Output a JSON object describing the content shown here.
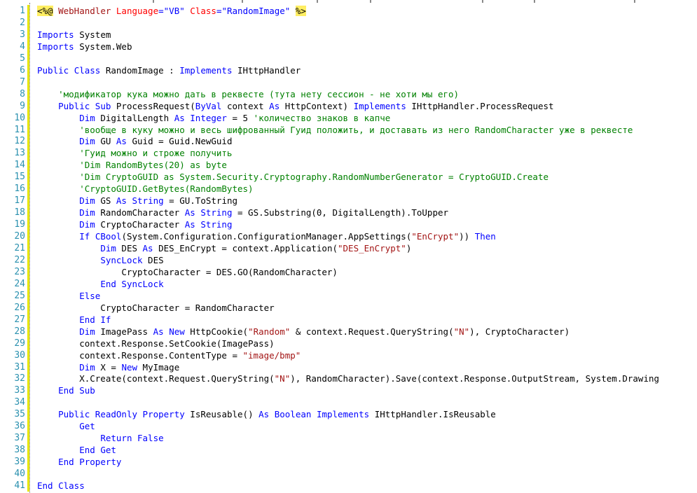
{
  "editor": {
    "language": "VB",
    "colors": {
      "line_number": "#2b91af",
      "keyword": "#0000ff",
      "string": "#a31515",
      "comment": "#008000",
      "directive_highlight": "#ffee62",
      "changed_line_marker": "#e6e600"
    },
    "lines": [
      {
        "n": "1",
        "changed": true,
        "tokens": [
          {
            "t": "dir",
            "v": "<%@"
          },
          {
            "t": "text",
            "v": " "
          },
          {
            "t": "str",
            "v": "WebHandler"
          },
          {
            "t": "text",
            "v": " "
          },
          {
            "t": "attr",
            "v": "Language"
          },
          {
            "t": "kw",
            "v": "=\"VB\""
          },
          {
            "t": "text",
            "v": " "
          },
          {
            "t": "attr",
            "v": "Class"
          },
          {
            "t": "kw",
            "v": "=\"RandomImage\""
          },
          {
            "t": "text",
            "v": " "
          },
          {
            "t": "dir",
            "v": "%>"
          }
        ]
      },
      {
        "n": "2",
        "changed": true,
        "tokens": []
      },
      {
        "n": "3",
        "changed": true,
        "tokens": [
          {
            "t": "kw",
            "v": "Imports"
          },
          {
            "t": "text",
            "v": " System"
          }
        ]
      },
      {
        "n": "4",
        "changed": true,
        "tokens": [
          {
            "t": "kw",
            "v": "Imports"
          },
          {
            "t": "text",
            "v": " System.Web"
          }
        ]
      },
      {
        "n": "5",
        "changed": true,
        "tokens": []
      },
      {
        "n": "6",
        "changed": true,
        "tokens": [
          {
            "t": "kw",
            "v": "Public"
          },
          {
            "t": "text",
            "v": " "
          },
          {
            "t": "kw",
            "v": "Class"
          },
          {
            "t": "text",
            "v": " RandomImage : "
          },
          {
            "t": "kw",
            "v": "Implements"
          },
          {
            "t": "text",
            "v": " IHttpHandler"
          }
        ]
      },
      {
        "n": "7",
        "changed": true,
        "tokens": []
      },
      {
        "n": "8",
        "changed": true,
        "tokens": [
          {
            "t": "text",
            "v": "    "
          },
          {
            "t": "cm",
            "v": "'модификатор кука можно дать в реквесте (тута нету сессион - не хоти мы его)"
          }
        ]
      },
      {
        "n": "9",
        "changed": true,
        "tokens": [
          {
            "t": "text",
            "v": "    "
          },
          {
            "t": "kw",
            "v": "Public"
          },
          {
            "t": "text",
            "v": " "
          },
          {
            "t": "kw",
            "v": "Sub"
          },
          {
            "t": "text",
            "v": " ProcessRequest("
          },
          {
            "t": "kw",
            "v": "ByVal"
          },
          {
            "t": "text",
            "v": " context "
          },
          {
            "t": "kw",
            "v": "As"
          },
          {
            "t": "text",
            "v": " HttpContext) "
          },
          {
            "t": "kw",
            "v": "Implements"
          },
          {
            "t": "text",
            "v": " IHttpHandler.ProcessRequest"
          }
        ]
      },
      {
        "n": "10",
        "changed": true,
        "tokens": [
          {
            "t": "text",
            "v": "        "
          },
          {
            "t": "kw",
            "v": "Dim"
          },
          {
            "t": "text",
            "v": " DigitalLength "
          },
          {
            "t": "kw",
            "v": "As"
          },
          {
            "t": "text",
            "v": " "
          },
          {
            "t": "kw",
            "v": "Integer"
          },
          {
            "t": "text",
            "v": " = 5 "
          },
          {
            "t": "cm",
            "v": "'количество знаков в капче"
          }
        ]
      },
      {
        "n": "11",
        "changed": true,
        "tokens": [
          {
            "t": "text",
            "v": "        "
          },
          {
            "t": "cm",
            "v": "'вообще в куку можно и весь шифрованный Гуид положить, и доставать из него RandomCharacter уже в реквесте"
          }
        ]
      },
      {
        "n": "12",
        "changed": true,
        "tokens": [
          {
            "t": "text",
            "v": "        "
          },
          {
            "t": "kw",
            "v": "Dim"
          },
          {
            "t": "text",
            "v": " GU "
          },
          {
            "t": "kw",
            "v": "As"
          },
          {
            "t": "text",
            "v": " Guid = Guid.NewGuid"
          }
        ]
      },
      {
        "n": "13",
        "changed": true,
        "tokens": [
          {
            "t": "text",
            "v": "        "
          },
          {
            "t": "cm",
            "v": "'Гуид можно и строже получить"
          }
        ]
      },
      {
        "n": "14",
        "changed": true,
        "tokens": [
          {
            "t": "text",
            "v": "        "
          },
          {
            "t": "cm",
            "v": "'Dim RandomBytes(20) as byte"
          }
        ]
      },
      {
        "n": "15",
        "changed": true,
        "tokens": [
          {
            "t": "text",
            "v": "        "
          },
          {
            "t": "cm",
            "v": "'Dim CryptoGUID as System.Security.Cryptography.RandomNumberGenerator = CryptoGUID.Create"
          }
        ]
      },
      {
        "n": "16",
        "changed": true,
        "tokens": [
          {
            "t": "text",
            "v": "        "
          },
          {
            "t": "cm",
            "v": "'CryptoGUID.GetBytes(RandomBytes)"
          }
        ]
      },
      {
        "n": "17",
        "changed": true,
        "tokens": [
          {
            "t": "text",
            "v": "        "
          },
          {
            "t": "kw",
            "v": "Dim"
          },
          {
            "t": "text",
            "v": " GS "
          },
          {
            "t": "kw",
            "v": "As"
          },
          {
            "t": "text",
            "v": " "
          },
          {
            "t": "kw",
            "v": "String"
          },
          {
            "t": "text",
            "v": " = GU.ToString"
          }
        ]
      },
      {
        "n": "18",
        "changed": true,
        "tokens": [
          {
            "t": "text",
            "v": "        "
          },
          {
            "t": "kw",
            "v": "Dim"
          },
          {
            "t": "text",
            "v": " RandomCharacter "
          },
          {
            "t": "kw",
            "v": "As"
          },
          {
            "t": "text",
            "v": " "
          },
          {
            "t": "kw",
            "v": "String"
          },
          {
            "t": "text",
            "v": " = GS.Substring(0, DigitalLength).ToUpper"
          }
        ]
      },
      {
        "n": "19",
        "changed": true,
        "tokens": [
          {
            "t": "text",
            "v": "        "
          },
          {
            "t": "kw",
            "v": "Dim"
          },
          {
            "t": "text",
            "v": " CryptoCharacter "
          },
          {
            "t": "kw",
            "v": "As"
          },
          {
            "t": "text",
            "v": " "
          },
          {
            "t": "kw",
            "v": "String"
          }
        ]
      },
      {
        "n": "20",
        "changed": true,
        "tokens": [
          {
            "t": "text",
            "v": "        "
          },
          {
            "t": "kw",
            "v": "If"
          },
          {
            "t": "text",
            "v": " "
          },
          {
            "t": "kw",
            "v": "CBool"
          },
          {
            "t": "text",
            "v": "(System.Configuration.ConfigurationManager.AppSettings("
          },
          {
            "t": "str",
            "v": "\"EnCrypt\""
          },
          {
            "t": "text",
            "v": ")) "
          },
          {
            "t": "kw",
            "v": "Then"
          }
        ]
      },
      {
        "n": "21",
        "changed": true,
        "tokens": [
          {
            "t": "text",
            "v": "            "
          },
          {
            "t": "kw",
            "v": "Dim"
          },
          {
            "t": "text",
            "v": " DES "
          },
          {
            "t": "kw",
            "v": "As"
          },
          {
            "t": "text",
            "v": " DES_EnCrypt = context.Application("
          },
          {
            "t": "str",
            "v": "\"DES_EnCrypt\""
          },
          {
            "t": "text",
            "v": ")"
          }
        ]
      },
      {
        "n": "22",
        "changed": true,
        "tokens": [
          {
            "t": "text",
            "v": "            "
          },
          {
            "t": "kw",
            "v": "SyncLock"
          },
          {
            "t": "text",
            "v": " DES"
          }
        ]
      },
      {
        "n": "23",
        "changed": true,
        "tokens": [
          {
            "t": "text",
            "v": "                CryptoCharacter = DES.GO(RandomCharacter)"
          }
        ]
      },
      {
        "n": "24",
        "changed": true,
        "tokens": [
          {
            "t": "text",
            "v": "            "
          },
          {
            "t": "kw",
            "v": "End"
          },
          {
            "t": "text",
            "v": " "
          },
          {
            "t": "kw",
            "v": "SyncLock"
          }
        ]
      },
      {
        "n": "25",
        "changed": true,
        "tokens": [
          {
            "t": "text",
            "v": "        "
          },
          {
            "t": "kw",
            "v": "Else"
          }
        ]
      },
      {
        "n": "26",
        "changed": true,
        "tokens": [
          {
            "t": "text",
            "v": "            CryptoCharacter = RandomCharacter"
          }
        ]
      },
      {
        "n": "27",
        "changed": true,
        "tokens": [
          {
            "t": "text",
            "v": "        "
          },
          {
            "t": "kw",
            "v": "End"
          },
          {
            "t": "text",
            "v": " "
          },
          {
            "t": "kw",
            "v": "If"
          }
        ]
      },
      {
        "n": "28",
        "changed": true,
        "tokens": [
          {
            "t": "text",
            "v": "        "
          },
          {
            "t": "kw",
            "v": "Dim"
          },
          {
            "t": "text",
            "v": " ImagePass "
          },
          {
            "t": "kw",
            "v": "As"
          },
          {
            "t": "text",
            "v": " "
          },
          {
            "t": "kw",
            "v": "New"
          },
          {
            "t": "text",
            "v": " HttpCookie("
          },
          {
            "t": "str",
            "v": "\"Random\""
          },
          {
            "t": "text",
            "v": " & context.Request.QueryString("
          },
          {
            "t": "str",
            "v": "\"N\""
          },
          {
            "t": "text",
            "v": "), CryptoCharacter)"
          }
        ]
      },
      {
        "n": "29",
        "changed": true,
        "tokens": [
          {
            "t": "text",
            "v": "        context.Response.SetCookie(ImagePass)"
          }
        ]
      },
      {
        "n": "30",
        "changed": true,
        "tokens": [
          {
            "t": "text",
            "v": "        context.Response.ContentType = "
          },
          {
            "t": "str",
            "v": "\"image/bmp\""
          }
        ]
      },
      {
        "n": "31",
        "changed": true,
        "tokens": [
          {
            "t": "text",
            "v": "        "
          },
          {
            "t": "kw",
            "v": "Dim"
          },
          {
            "t": "text",
            "v": " X = "
          },
          {
            "t": "kw",
            "v": "New"
          },
          {
            "t": "text",
            "v": " MyImage"
          }
        ]
      },
      {
        "n": "32",
        "changed": true,
        "tokens": [
          {
            "t": "text",
            "v": "        X.Create(context.Request.QueryString("
          },
          {
            "t": "str",
            "v": "\"N\""
          },
          {
            "t": "text",
            "v": "), RandomCharacter).Save(context.Response.OutputStream, System.Drawing"
          }
        ]
      },
      {
        "n": "33",
        "changed": true,
        "tokens": [
          {
            "t": "text",
            "v": "    "
          },
          {
            "t": "kw",
            "v": "End"
          },
          {
            "t": "text",
            "v": " "
          },
          {
            "t": "kw",
            "v": "Sub"
          }
        ]
      },
      {
        "n": "34",
        "changed": true,
        "tokens": []
      },
      {
        "n": "35",
        "changed": true,
        "tokens": [
          {
            "t": "text",
            "v": "    "
          },
          {
            "t": "kw",
            "v": "Public"
          },
          {
            "t": "text",
            "v": " "
          },
          {
            "t": "kw",
            "v": "ReadOnly"
          },
          {
            "t": "text",
            "v": " "
          },
          {
            "t": "kw",
            "v": "Property"
          },
          {
            "t": "text",
            "v": " IsReusable() "
          },
          {
            "t": "kw",
            "v": "As"
          },
          {
            "t": "text",
            "v": " "
          },
          {
            "t": "kw",
            "v": "Boolean"
          },
          {
            "t": "text",
            "v": " "
          },
          {
            "t": "kw",
            "v": "Implements"
          },
          {
            "t": "text",
            "v": " IHttpHandler.IsReusable"
          }
        ]
      },
      {
        "n": "36",
        "changed": true,
        "tokens": [
          {
            "t": "text",
            "v": "        "
          },
          {
            "t": "kw",
            "v": "Get"
          }
        ]
      },
      {
        "n": "37",
        "changed": true,
        "tokens": [
          {
            "t": "text",
            "v": "            "
          },
          {
            "t": "kw",
            "v": "Return"
          },
          {
            "t": "text",
            "v": " "
          },
          {
            "t": "kw",
            "v": "False"
          }
        ]
      },
      {
        "n": "38",
        "changed": true,
        "tokens": [
          {
            "t": "text",
            "v": "        "
          },
          {
            "t": "kw",
            "v": "End"
          },
          {
            "t": "text",
            "v": " "
          },
          {
            "t": "kw",
            "v": "Get"
          }
        ]
      },
      {
        "n": "39",
        "changed": true,
        "tokens": [
          {
            "t": "text",
            "v": "    "
          },
          {
            "t": "kw",
            "v": "End"
          },
          {
            "t": "text",
            "v": " "
          },
          {
            "t": "kw",
            "v": "Property"
          }
        ]
      },
      {
        "n": "40",
        "changed": true,
        "tokens": []
      },
      {
        "n": "41",
        "changed": true,
        "tokens": [
          {
            "t": "kw",
            "v": "End"
          },
          {
            "t": "text",
            "v": " "
          },
          {
            "t": "kw",
            "v": "Class"
          }
        ]
      }
    ]
  }
}
